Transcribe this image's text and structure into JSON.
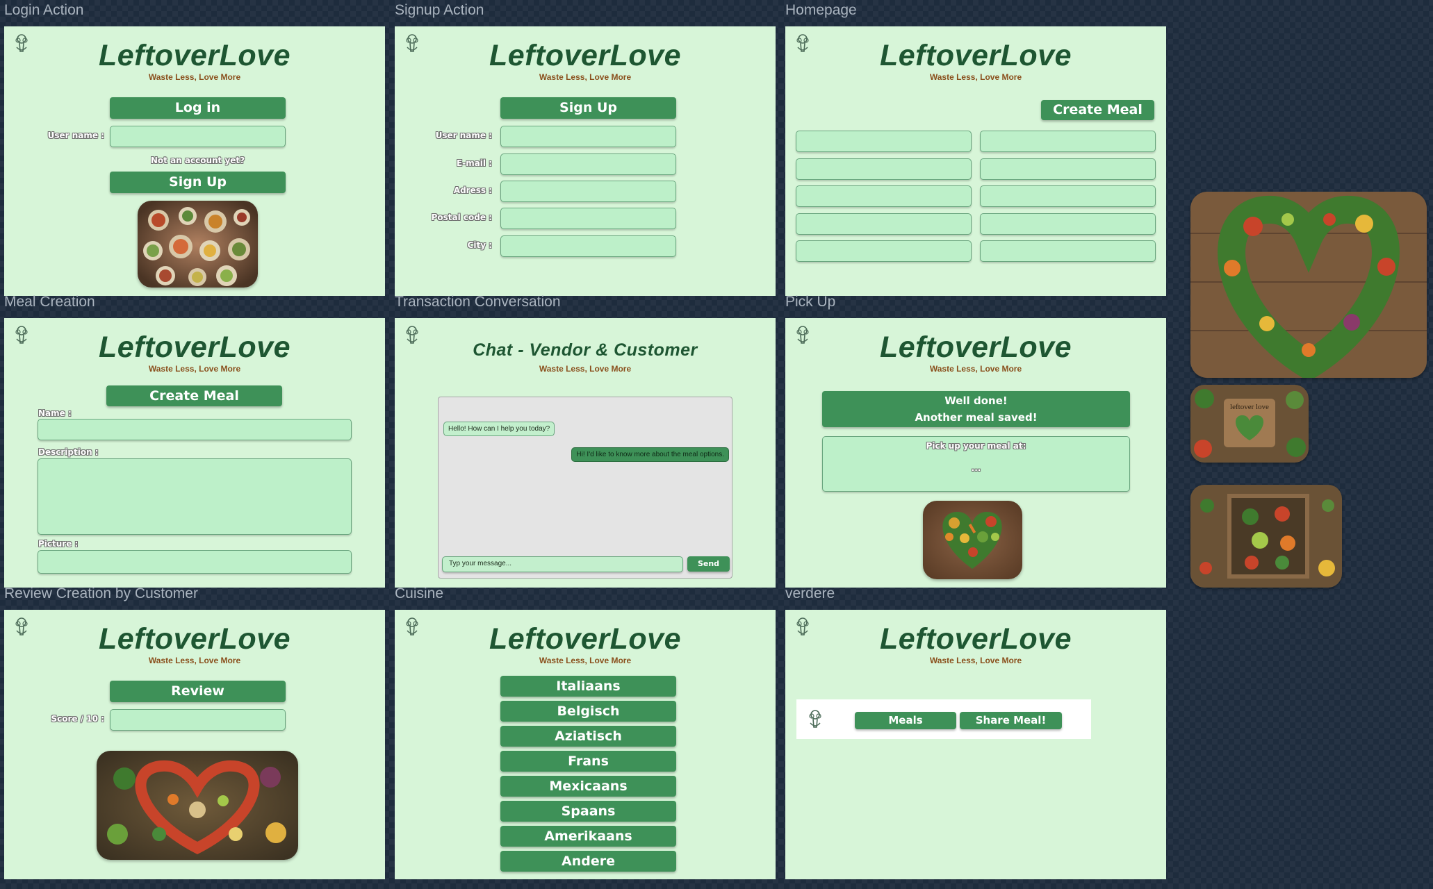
{
  "brand": {
    "name": "LeftoverLove",
    "tagline": "Waste Less, Love More"
  },
  "frame_labels": {
    "login": "Login Action",
    "signup": "Signup Action",
    "homepage": "Homepage",
    "meal_creation": "Meal Creation",
    "chat": "Transaction Conversation",
    "pickup": "Pick Up",
    "review": "Review Creation by Customer",
    "cuisine": "Cuisine",
    "verdere": "verdere"
  },
  "login": {
    "title_button": "Log in",
    "username_label": "User name :",
    "not_account": "Not an account yet?",
    "signup_button": "Sign Up"
  },
  "signup": {
    "title_button": "Sign Up",
    "username_label": "User name :",
    "email_label": "E-mail :",
    "address_label": "Adress :",
    "postal_label": "Postal code :",
    "city_label": "City :"
  },
  "homepage": {
    "create_button": "Create Meal"
  },
  "meal_creation": {
    "title_button": "Create Meal",
    "name_label": "Name :",
    "description_label": "Description :",
    "picture_label": "Picture :"
  },
  "chat": {
    "title": "Chat - Vendor & Customer",
    "message_vendor": "Hello! How can I help you today?",
    "message_customer": "Hi! I'd like to know more about the meal options.",
    "input_placeholder": "Typ your message...",
    "send_button": "Send"
  },
  "pickup": {
    "banner_line1": "Well done!",
    "banner_line2": "Another meal saved!",
    "pickup_label": "Pick up your meal at:",
    "pickup_value": "..."
  },
  "review": {
    "title_button": "Review",
    "score_label": "Score / 10 :"
  },
  "cuisine": {
    "options": [
      "Italiaans",
      "Belgisch",
      "Aziatisch",
      "Frans",
      "Mexicaans",
      "Spaans",
      "Amerikaans",
      "Andere"
    ]
  },
  "verdere": {
    "nav_meals": "Meals",
    "nav_share": "Share Meal!"
  },
  "sidebar_pictures": {
    "small_sign_text": "leftover love"
  },
  "colors": {
    "canvas": "#1e2c3d",
    "frame": "#d7f5d8",
    "brand": "#1e5632",
    "tagline": "#8a4f1c",
    "button": "#3e9158",
    "field": "#bdf0c9",
    "chat_bubble_vendor": "#c3efcd",
    "chat_bubble_customer": "#3e9158"
  },
  "icons": {
    "logo": "broccoli-heart-logo-icon"
  }
}
